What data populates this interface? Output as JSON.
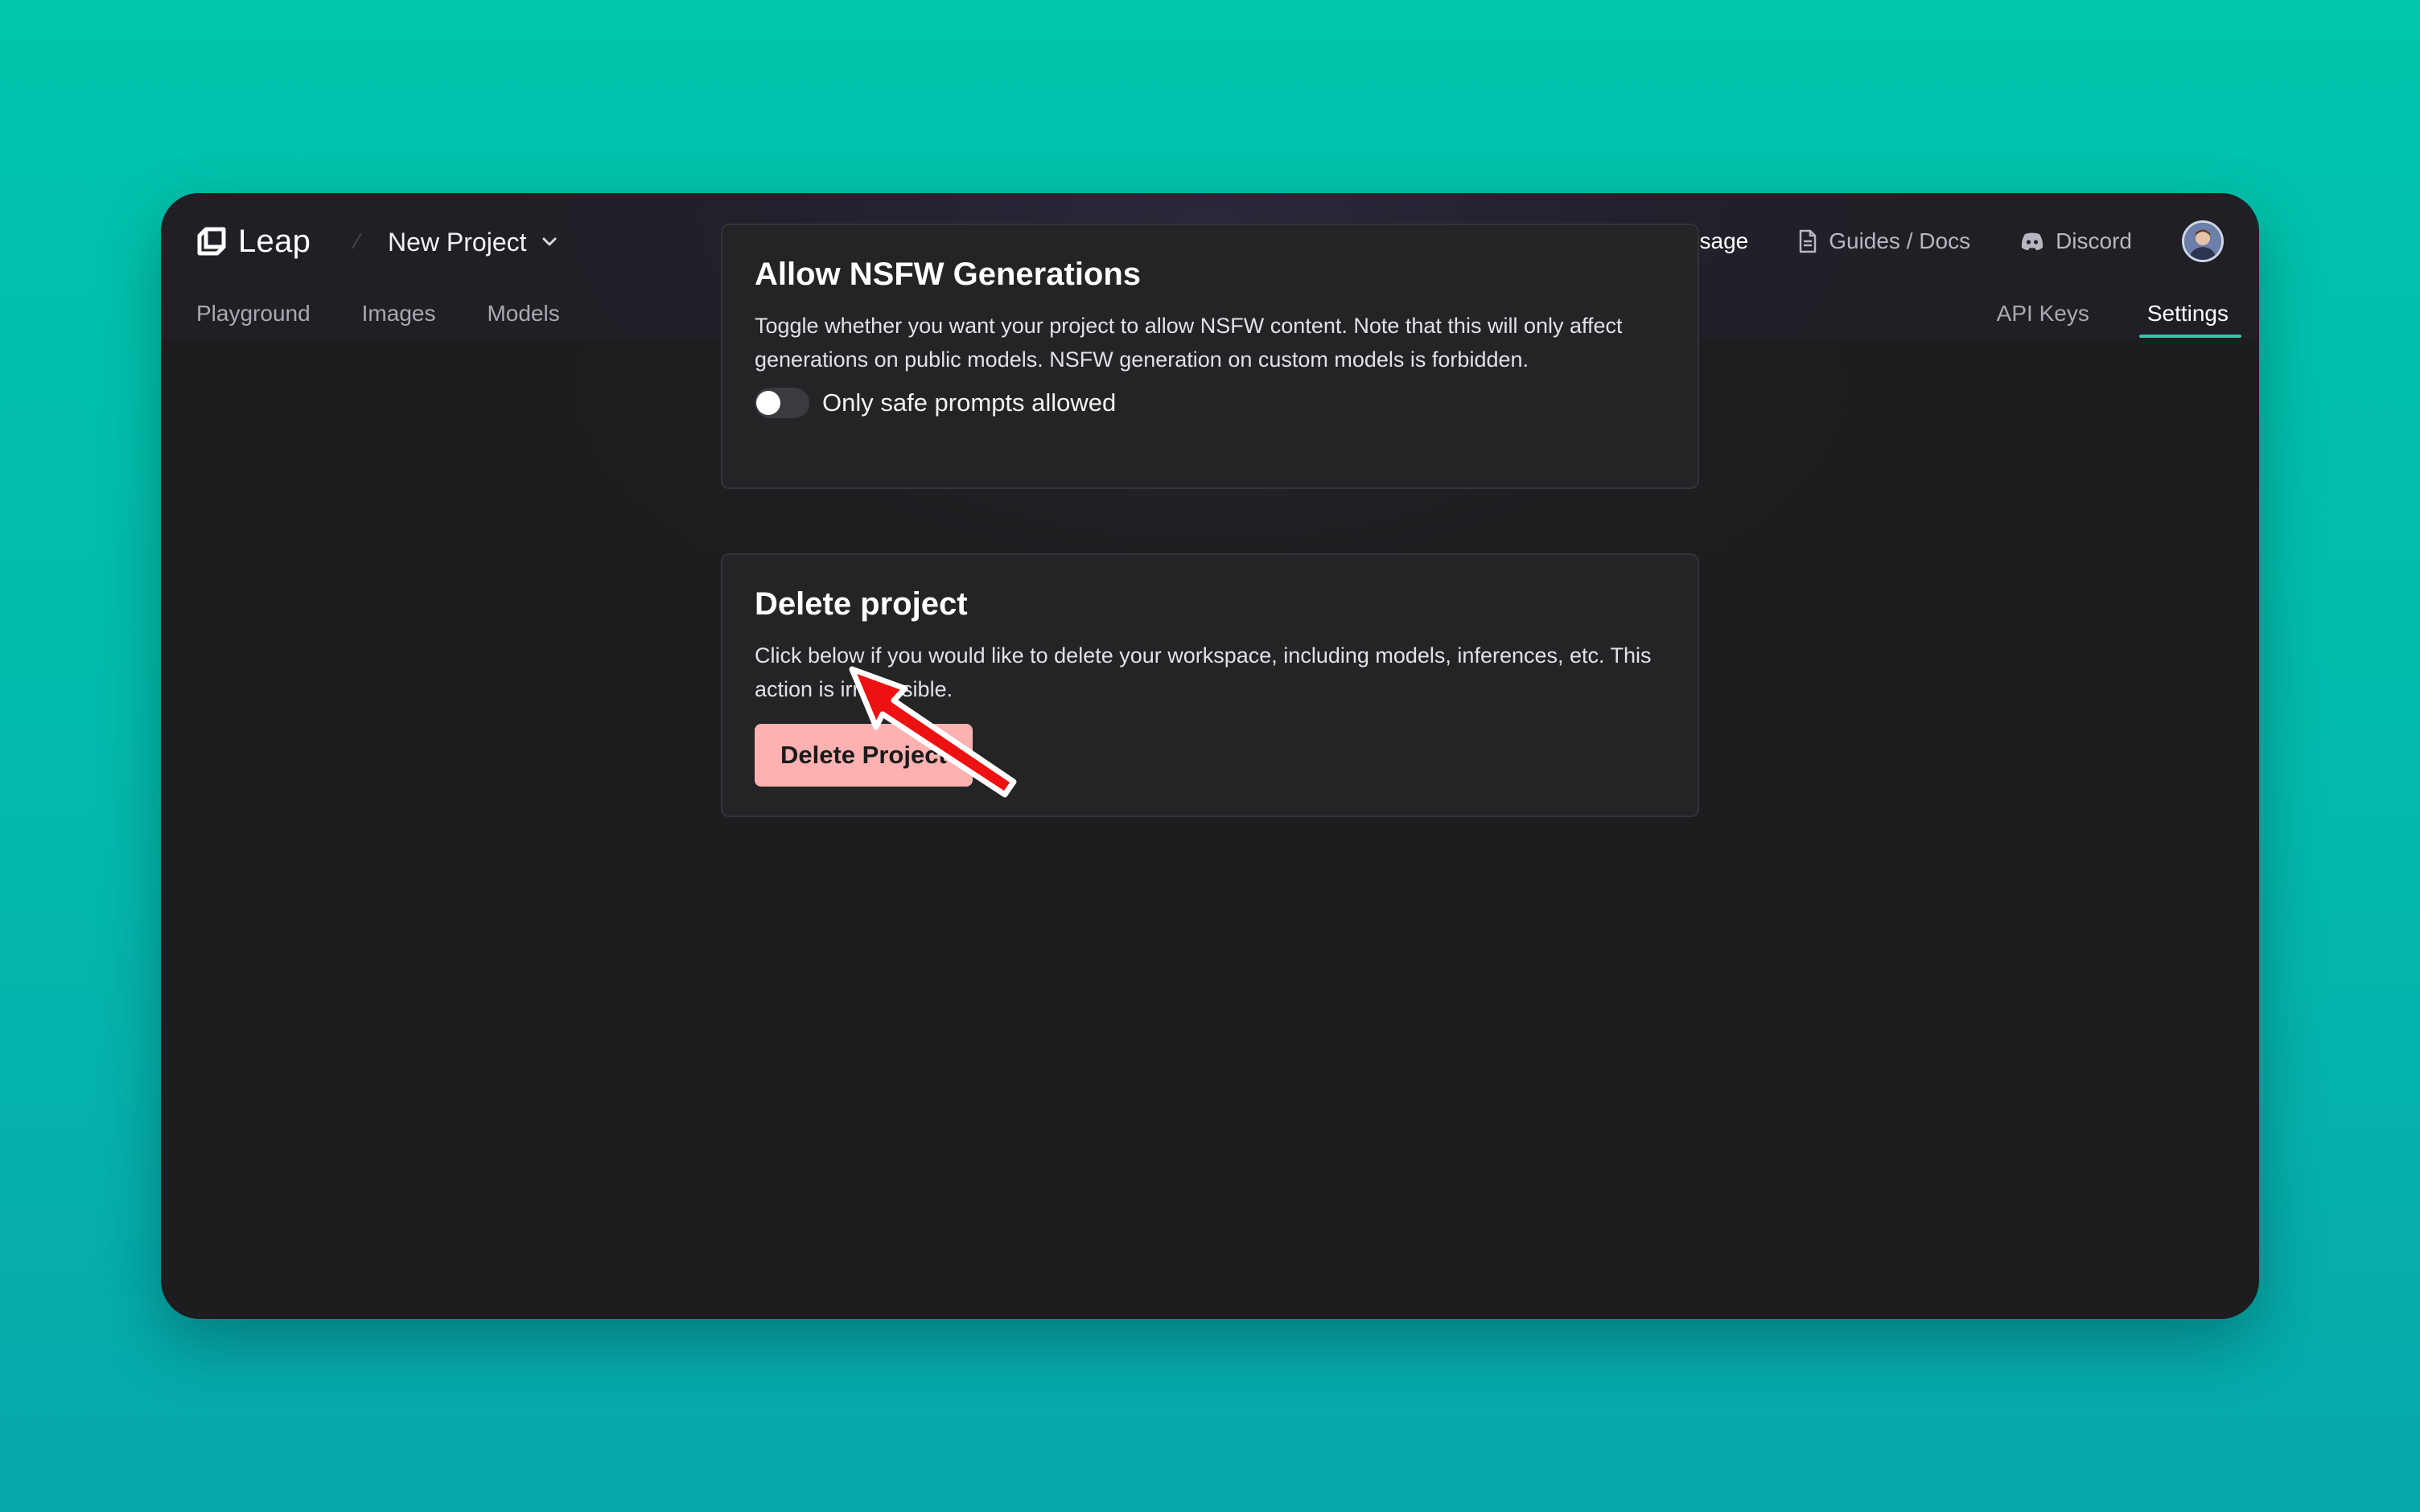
{
  "app": {
    "brand_name": "Leap",
    "project_name": "New Project"
  },
  "header": {
    "view_usage_label": "View Usage",
    "guides_label": "Guides / Docs",
    "discord_label": "Discord"
  },
  "nav": {
    "left_tabs": [
      "Playground",
      "Images",
      "Models"
    ],
    "right_tabs": [
      "API Keys",
      "Settings"
    ],
    "active_tab": "Settings"
  },
  "nsfw_card": {
    "title": "Allow NSFW Generations",
    "description": "Toggle whether you want your project to allow NSFW content. Note that this will only affect generations on public models. NSFW generation on custom models is forbidden.",
    "toggle_label": "Only safe prompts allowed",
    "toggle_on": false
  },
  "delete_card": {
    "title": "Delete project",
    "description": "Click below if you would like to delete your workspace, including models, inferences, etc. This action is irreversible.",
    "button_label": "Delete Project"
  },
  "icons": {
    "logo": "leap-logo-icon",
    "project_dropdown": "chevron-down-icon",
    "view_usage": "lightning-bolt-icon",
    "guides": "document-icon",
    "discord": "discord-icon",
    "annotation": "red-arrow-icon"
  },
  "colors": {
    "background_gradient_top": "#00c6ad",
    "background_gradient_bottom": "#07a6ac",
    "app_bg": "#1d1d1f",
    "card_bg": "#242427",
    "active_tab_underline": "#2fc8a9",
    "delete_button_bg": "#fdb1b0",
    "annotation_arrow": "#ee1111"
  }
}
